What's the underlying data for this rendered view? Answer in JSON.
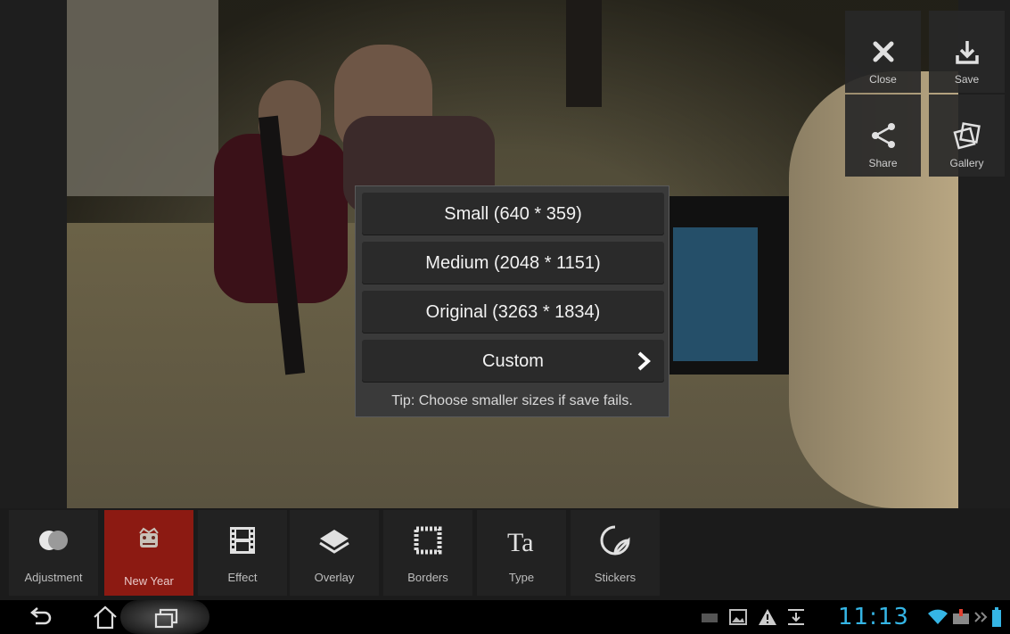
{
  "top_actions": [
    {
      "label": "Close",
      "icon": "close-icon"
    },
    {
      "label": "Save",
      "icon": "download-icon"
    },
    {
      "label": "Share",
      "icon": "share-icon"
    },
    {
      "label": "Gallery",
      "icon": "gallery-icon"
    }
  ],
  "save_dialog": {
    "options": [
      "Small (640 * 359)",
      "Medium (2048 * 1151)",
      "Original (3263 * 1834)",
      "Custom"
    ],
    "tip": "Tip: Choose smaller sizes if save fails."
  },
  "toolbar": {
    "tools": [
      {
        "label": "Adjustment",
        "icon": "adjustment-icon"
      },
      {
        "label": "New Year",
        "icon": "new-year-icon",
        "active": true
      },
      {
        "label": "Effect",
        "icon": "film-icon"
      },
      {
        "label": "Overlay",
        "icon": "layers-icon"
      },
      {
        "label": "Borders",
        "icon": "border-icon"
      },
      {
        "label": "Type",
        "icon": "type-icon"
      },
      {
        "label": "Stickers",
        "icon": "sticker-icon"
      }
    ]
  },
  "status_bar": {
    "time": "11:13",
    "accent_color": "#35b5e5"
  },
  "colors": {
    "active_tool": "#8c1a12"
  }
}
